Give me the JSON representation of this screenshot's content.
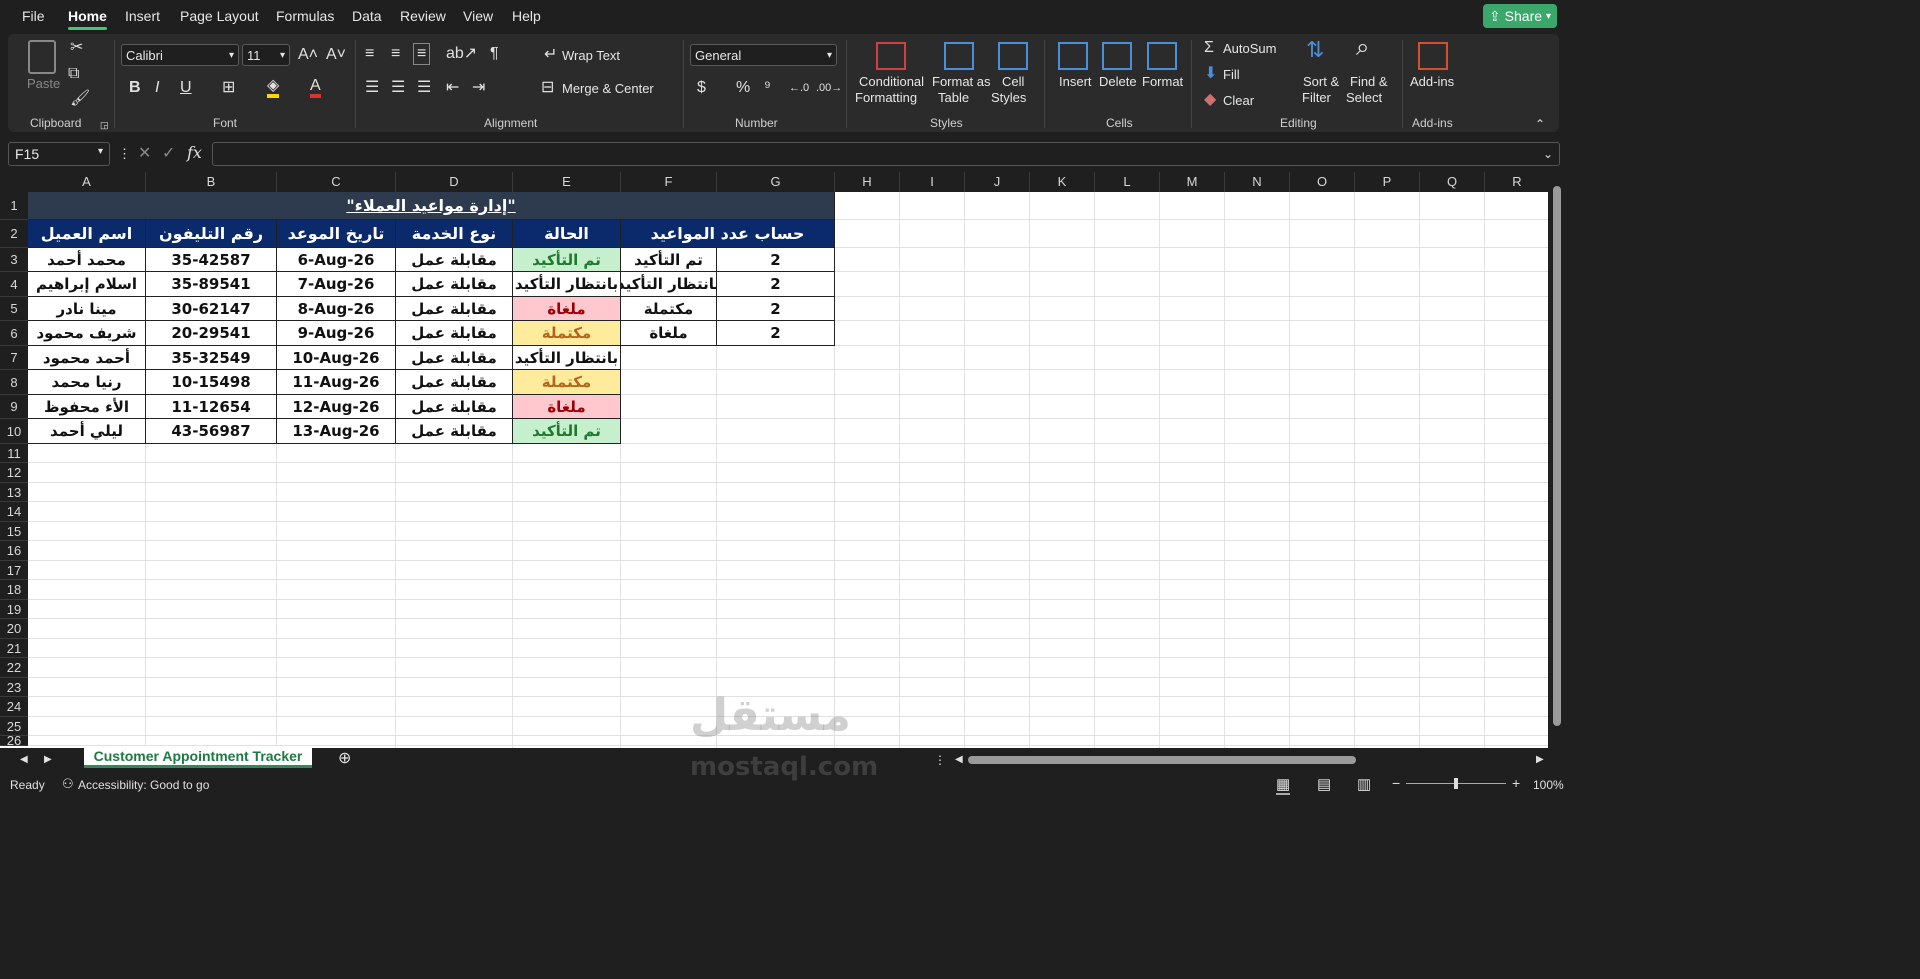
{
  "menu": {
    "items": [
      "File",
      "Home",
      "Insert",
      "Page Layout",
      "Formulas",
      "Data",
      "Review",
      "View",
      "Help"
    ],
    "active": "Home",
    "share_label": "Share"
  },
  "ribbon": {
    "clipboard": {
      "paste_label": "Paste",
      "group_label": "Clipboard"
    },
    "font": {
      "font_name": "Calibri",
      "font_size": "11",
      "group_label": "Font"
    },
    "alignment": {
      "wrap_text": "Wrap Text",
      "merge_center": "Merge & Center",
      "group_label": "Alignment"
    },
    "number": {
      "format": "General",
      "group_label": "Number"
    },
    "styles": {
      "conditional_l1": "Conditional",
      "conditional_l2": "Formatting",
      "format_table_l1": "Format as",
      "format_table_l2": "Table",
      "cell_styles_l1": "Cell",
      "cell_styles_l2": "Styles",
      "group_label": "Styles"
    },
    "cells": {
      "insert": "Insert",
      "delete": "Delete",
      "format": "Format",
      "group_label": "Cells"
    },
    "editing": {
      "autosum": "AutoSum",
      "fill": "Fill",
      "clear": "Clear",
      "sort_l1": "Sort &",
      "sort_l2": "Filter",
      "find_l1": "Find &",
      "find_l2": "Select",
      "group_label": "Editing"
    },
    "addins": {
      "label": "Add-ins",
      "group_label": "Add-ins"
    }
  },
  "formula_bar": {
    "name_box": "F15",
    "formula": ""
  },
  "columns": [
    "A",
    "B",
    "C",
    "D",
    "E",
    "F",
    "G",
    "H",
    "I",
    "J",
    "K",
    "L",
    "M",
    "N",
    "O",
    "P",
    "Q",
    "R"
  ],
  "rows": [
    "1",
    "2",
    "3",
    "4",
    "5",
    "6",
    "7",
    "8",
    "9",
    "10",
    "11",
    "12",
    "13",
    "14",
    "15",
    "16",
    "17",
    "18",
    "19",
    "20",
    "21",
    "22",
    "23",
    "24",
    "25",
    "26"
  ],
  "sheet": {
    "title": "\"إدارة مواعيد العملاء\"",
    "headers": [
      "اسم العميل",
      "رقم التليفون",
      "تاريخ الموعد",
      "نوع الخدمة",
      "الحالة",
      "حساب عدد المواعيد"
    ],
    "data": [
      [
        "محمد أحمد",
        "35-42587",
        "6-Aug-26",
        "مقابلة عمل",
        "تم التأكيد"
      ],
      [
        "اسلام إبراهيم",
        "35-89541",
        "7-Aug-26",
        "مقابلة عمل",
        "بانتظار التأكيد"
      ],
      [
        "مينا نادر",
        "30-62147",
        "8-Aug-26",
        "مقابلة عمل",
        "ملغاة"
      ],
      [
        "شريف محمود",
        "20-29541",
        "9-Aug-26",
        "مقابلة عمل",
        "مكتملة"
      ],
      [
        "أحمد محمود",
        "35-32549",
        "10-Aug-26",
        "مقابلة عمل",
        "بانتظار التأكيد"
      ],
      [
        "رنيا محمد",
        "10-15498",
        "11-Aug-26",
        "مقابلة عمل",
        "مكتملة"
      ],
      [
        "الأء محفوظ",
        "11-12654",
        "12-Aug-26",
        "مقابلة عمل",
        "ملغاة"
      ],
      [
        "ليلي أحمد",
        "43-56987",
        "13-Aug-26",
        "مقابلة عمل",
        "تم التأكيد"
      ]
    ],
    "summary": [
      [
        "تم التأكيد",
        "2"
      ],
      [
        "بانتظار التأكيد",
        "2"
      ],
      [
        "مكتملة",
        "2"
      ],
      [
        "ملغاة",
        "2"
      ]
    ],
    "status_colors": {
      "تم التأكيد": {
        "bg": "#c6efce",
        "fg": "#1f7a2e"
      },
      "بانتظار التأكيد": {
        "bg": "#ffffff",
        "fg": "#111111"
      },
      "ملغاة": {
        "bg": "#ffc7ce",
        "fg": "#9c0006"
      },
      "مكتملة": {
        "bg": "#ffeb9c",
        "fg": "#b5651d"
      }
    }
  },
  "tabs": {
    "sheet_name": "Customer Appointment Tracker"
  },
  "status": {
    "ready": "Ready",
    "accessibility": "Accessibility: Good to go",
    "zoom": "100%"
  },
  "watermark": {
    "arabic": "مستقل",
    "latin": "mostaql.com"
  },
  "colors": {
    "accent": "#3aa86b",
    "header_bg": "#0b2a6b",
    "title_bg": "#2e3a4e"
  }
}
